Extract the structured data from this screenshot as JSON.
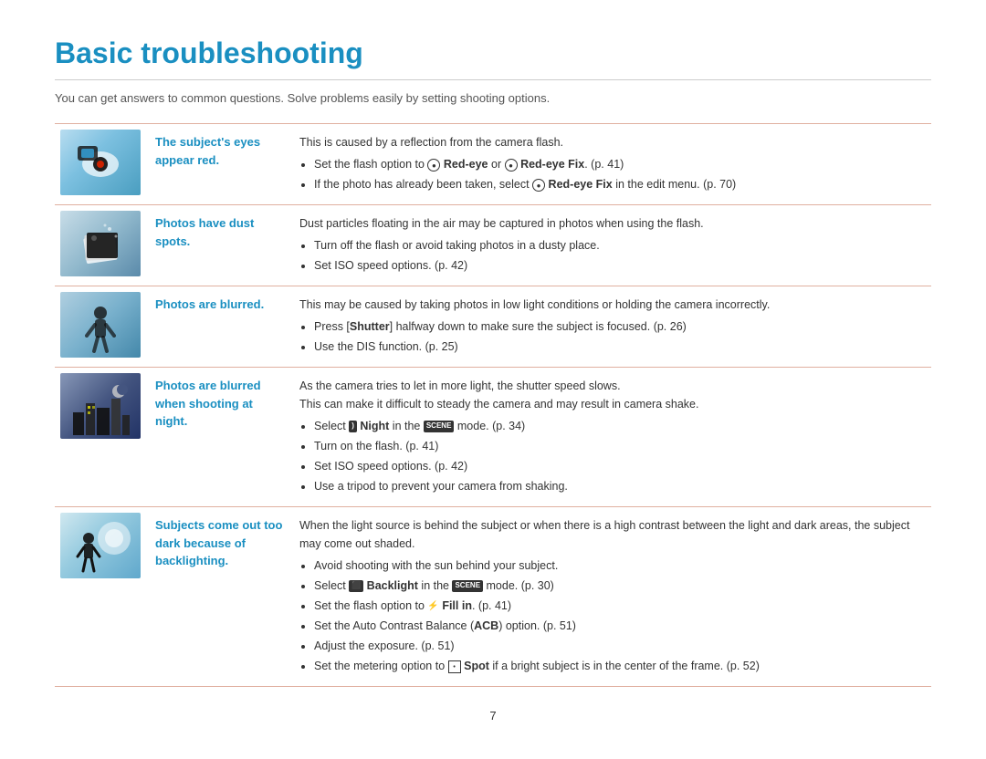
{
  "page": {
    "title": "Basic troubleshooting",
    "subtitle": "You can get answers to common questions. Solve problems easily by setting shooting options.",
    "page_number": "7"
  },
  "rows": [
    {
      "id": "red-eye",
      "label": "The subject's eyes appear red.",
      "description_intro": "This is caused by a reflection from the camera flash.",
      "bullets": [
        "Set the flash option to [RED-EYE] Red-eye or [RED-EYE-FIX] Red-eye Fix. (p. 41)",
        "If the photo has already been taken, select [RED-EYE-FIX] Red-eye Fix in the edit menu. (p. 70)"
      ]
    },
    {
      "id": "dust",
      "label": "Photos have dust spots.",
      "description_intro": "Dust particles floating in the air may be captured in photos when using the flash.",
      "bullets": [
        "Turn off the flash or avoid taking photos in a dusty place.",
        "Set ISO speed options. (p. 42)"
      ]
    },
    {
      "id": "blurred",
      "label": "Photos are blurred.",
      "description_intro": "This may be caused by taking photos in low light conditions or holding the camera incorrectly.",
      "bullets": [
        "Press [Shutter] halfway down to make sure the subject is focused. (p. 26)",
        "Use the DIS function. (p. 25)"
      ]
    },
    {
      "id": "night",
      "label": "Photos are blurred when shooting at night.",
      "description_intro": "As the camera tries to let in more light, the shutter speed slows.",
      "description_intro2": "This can make it difficult to steady the camera and may result in camera shake.",
      "bullets": [
        "Select [NIGHT] Night in the [SCENE] mode. (p. 34)",
        "Turn on the flash. (p. 41)",
        "Set ISO speed options. (p. 42)",
        "Use a tripod to prevent your camera from shaking."
      ]
    },
    {
      "id": "backlight",
      "label": "Subjects come out too dark because of backlighting.",
      "description_intro": "When the light source is behind the subject or when there is a high contrast between the light and dark areas, the subject may come out shaded.",
      "bullets": [
        "Avoid shooting with the sun behind your subject.",
        "Select [BACKLIGHT] Backlight in the [SCENE] mode. (p. 30)",
        "Set the flash option to [FILL] Fill in. (p. 41)",
        "Set the Auto Contrast Balance (ACB) option. (p. 51)",
        "Adjust the exposure. (p. 51)",
        "Set the metering option to [SPOT] Spot if a bright subject is in the center of the frame. (p. 52)"
      ]
    }
  ]
}
